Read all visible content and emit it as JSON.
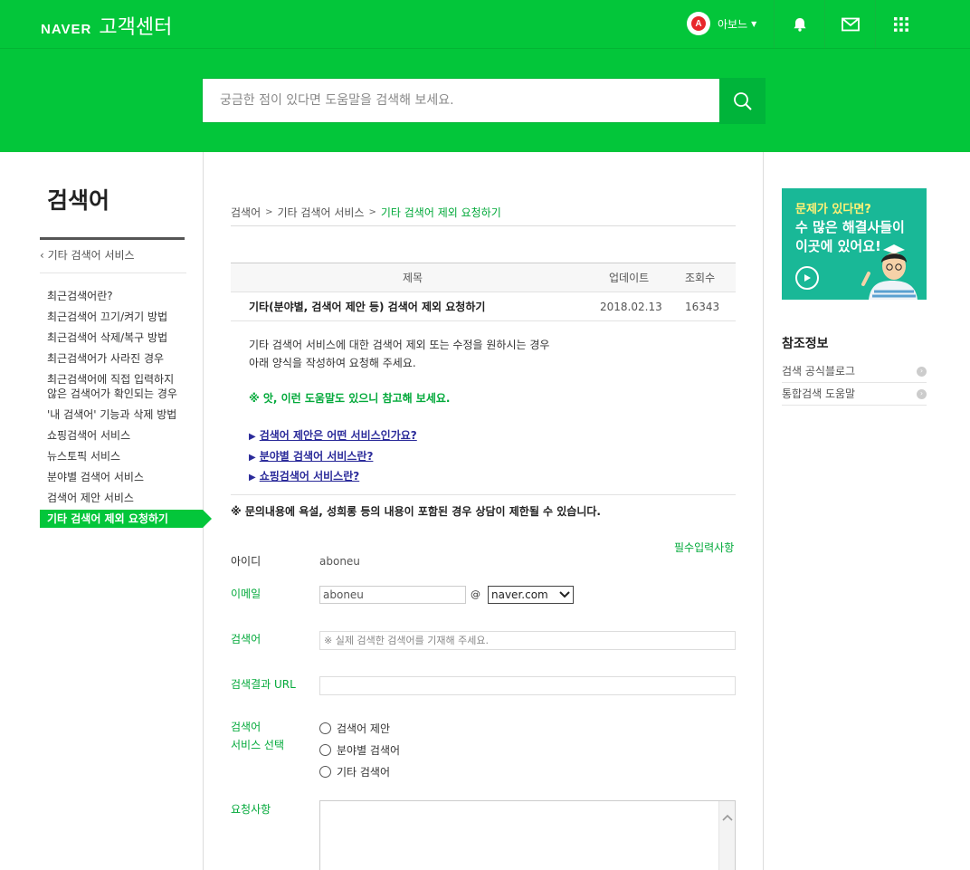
{
  "header": {
    "logo": "NAVER",
    "title": "고객센터",
    "user_name": "아보느",
    "user_initial": "A",
    "accent_color": "#03c63a"
  },
  "search": {
    "placeholder": "궁금한 점이 있다면 도움말을 검색해 보세요."
  },
  "lnb": {
    "title": "검색어",
    "back_label": "기타 검색어 서비스",
    "items": [
      "최근검색어란?",
      "최근검색어 끄기/켜기 방법",
      "최근검색어 삭제/복구 방법",
      "최근검색어가 사라진 경우",
      "최근검색어에 직접 입력하지 않은 검색어가 확인되는 경우",
      "'내 검색어' 기능과 삭제 방법",
      "쇼핑검색어 서비스",
      "뉴스토픽 서비스",
      "분야별 검색어 서비스",
      "검색어 제안 서비스",
      "기타 검색어 제외 요청하기"
    ],
    "active_index": 10
  },
  "breadcrumb": {
    "items": [
      "검색어",
      "기타 검색어 서비스",
      "기타 검색어 제외 요청하기"
    ]
  },
  "table": {
    "headers": {
      "title": "제목",
      "updated": "업데이트",
      "views": "조회수"
    },
    "row": {
      "title": "기타(분야별, 검색어 제안 등) 검색어 제외 요청하기",
      "updated": "2018.02.13",
      "views": "16343"
    }
  },
  "content": {
    "desc_line1": "기타 검색어 서비스에 대한 검색어 제외 또는 수정을 원하시는 경우",
    "desc_line2": "아래 양식을 작성하여 요청해 주세요.",
    "tip": "※ 앗, 이런 도움말도 있으니 참고해 보세요.",
    "links": [
      "검색어 제안은 어떤 서비스인가요?",
      "분야별 검색어 서비스란?",
      "쇼핑검색어 서비스란?"
    ],
    "warning": "※ 문의내용에 욕설, 성희롱 등의 내용이 포함된 경우 상담이 제한될 수 있습니다."
  },
  "form": {
    "required_note": "필수입력사항",
    "id_label": "아이디",
    "id_value": "aboneu",
    "email_label": "이메일",
    "email_value": "aboneu",
    "email_at": "@",
    "email_domain": "naver.com",
    "keyword_label": "검색어",
    "keyword_placeholder": "※ 실제 검색한 검색어를 기재해 주세요.",
    "url_label": "검색결과 URL",
    "service_label_1": "검색어",
    "service_label_2": "서비스 선택",
    "service_options": [
      "검색어 제안",
      "분야별 검색어",
      "기타 검색어"
    ],
    "request_label": "요청사항"
  },
  "right": {
    "promo_line1": "문제가 있다면?",
    "promo_line2": "수 많은 해결사들이",
    "promo_line3": "이곳에 있어요!",
    "ref_title": "참조정보",
    "ref_items": [
      "검색 공식블로그",
      "통합검색 도움말"
    ]
  }
}
